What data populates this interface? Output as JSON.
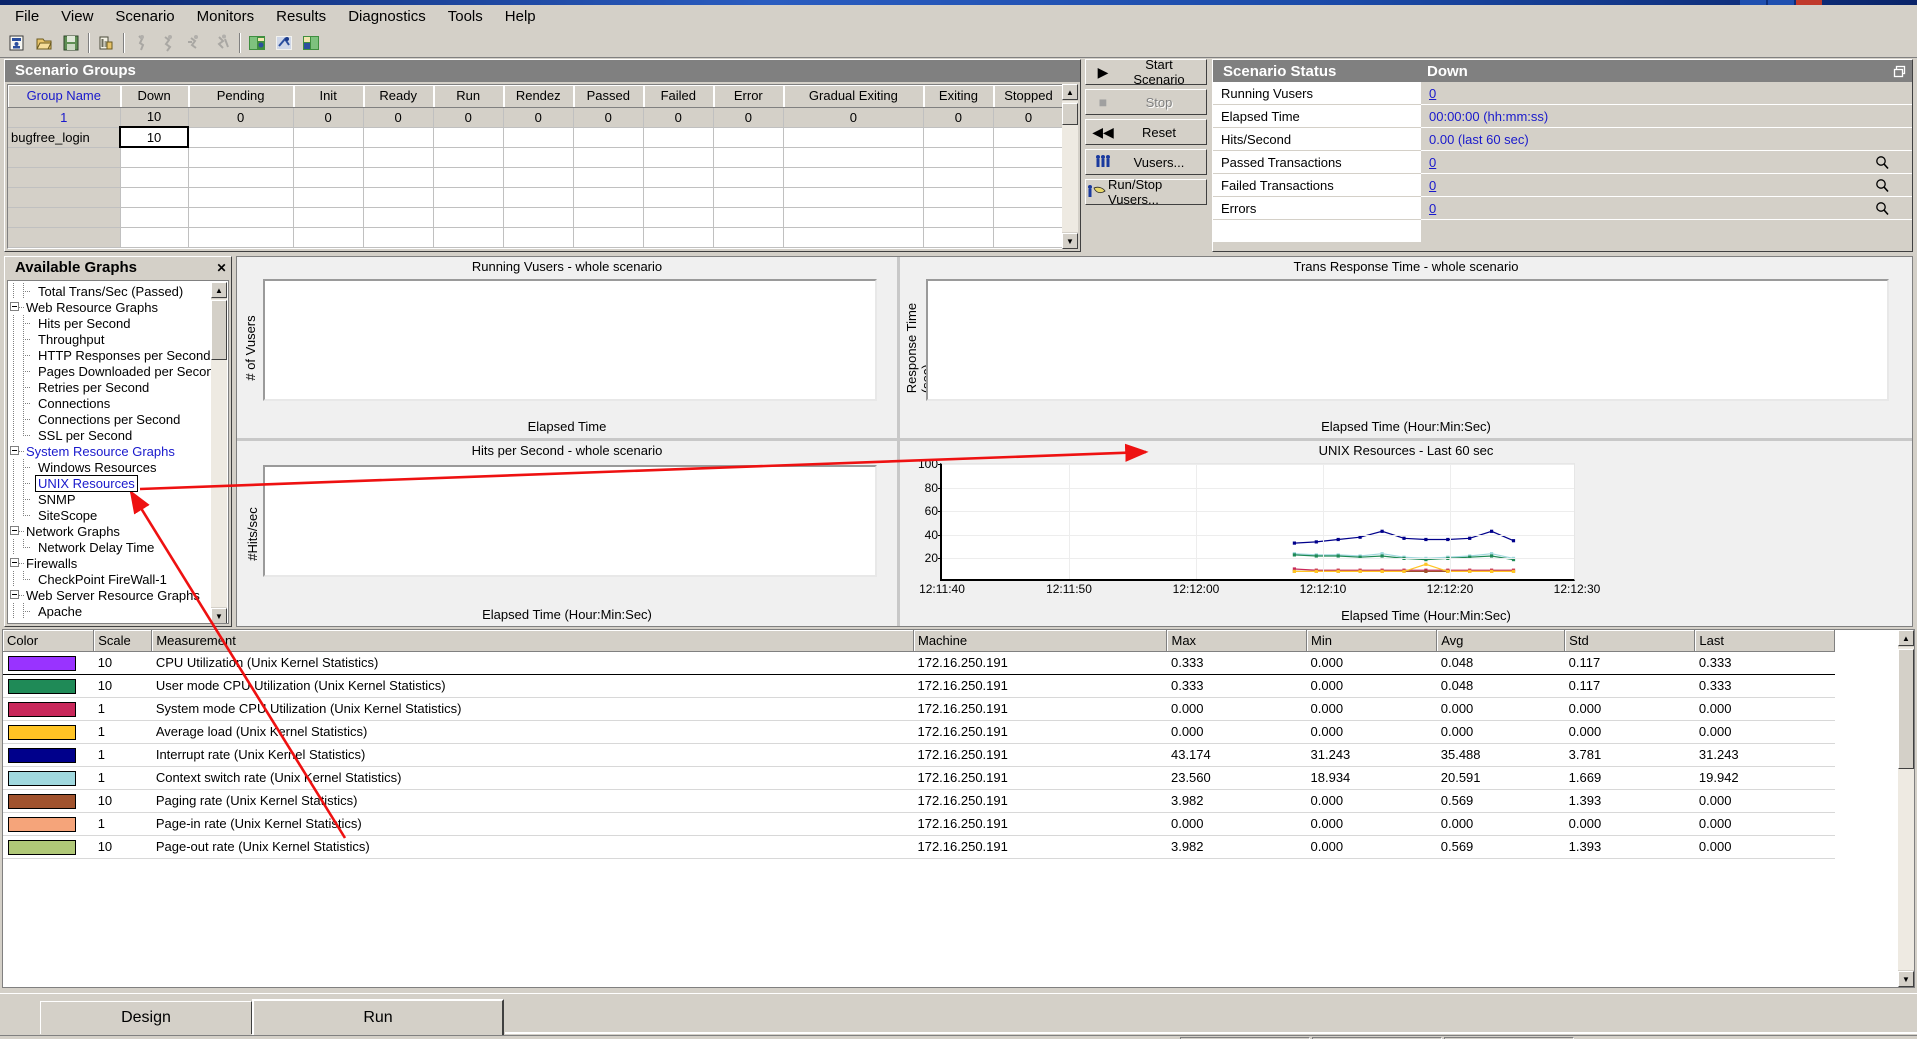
{
  "window": {
    "app_title": ""
  },
  "menubar": {
    "items": [
      {
        "label": "File"
      },
      {
        "label": "View"
      },
      {
        "label": "Scenario"
      },
      {
        "label": "Monitors"
      },
      {
        "label": "Results"
      },
      {
        "label": "Diagnostics"
      },
      {
        "label": "Tools"
      },
      {
        "label": "Help"
      }
    ]
  },
  "toolbar": {
    "buttons": [
      {
        "name": "new-scenario-icon"
      },
      {
        "name": "open-scenario-icon"
      },
      {
        "name": "save-scenario-icon"
      },
      {
        "name": "separator"
      },
      {
        "name": "report-icon"
      },
      {
        "name": "separator"
      },
      {
        "name": "start-scenario-icon"
      },
      {
        "name": "stop-scenario-icon"
      },
      {
        "name": "reset-scenario-icon"
      },
      {
        "name": "stop-now-icon"
      },
      {
        "name": "separator"
      },
      {
        "name": "vuser-details-icon"
      },
      {
        "name": "run-stop-vusers-icon"
      },
      {
        "name": "design-view-icon"
      }
    ]
  },
  "scenario_groups": {
    "title": "Scenario Groups",
    "columns": [
      "Group Name",
      "Down",
      "Pending",
      "Init",
      "Ready",
      "Run",
      "Rendez",
      "Passed",
      "Failed",
      "Error",
      "Gradual Exiting",
      "Exiting",
      "Stopped"
    ],
    "totals_row": [
      "1",
      "10",
      "0",
      "0",
      "0",
      "0",
      "0",
      "0",
      "0",
      "0",
      "0",
      "0",
      "0"
    ],
    "rows": [
      {
        "group_name": "bugfree_login",
        "down": "10",
        "selected_cell": "down"
      }
    ],
    "empty_row_count": 5
  },
  "controls": {
    "buttons": [
      {
        "label": "Start Scenario",
        "icon": "play-icon",
        "accel": "S",
        "disabled": false
      },
      {
        "label": "Stop",
        "icon": "stop-icon",
        "accel": "t",
        "disabled": true
      },
      {
        "label": "Reset",
        "icon": "rewind-icon",
        "accel": "e",
        "disabled": false
      },
      {
        "label": "Vusers...",
        "icon": "vusers-icon",
        "accel": "u",
        "disabled": false
      },
      {
        "label": "Run/Stop Vusers...",
        "icon": "run-stop-vusers-icon",
        "accel": "p",
        "disabled": false
      }
    ]
  },
  "scenario_status": {
    "title": "Scenario Status",
    "state": "Down",
    "restore_icon": "restore-window-icon",
    "rows": [
      {
        "label": "Running Vusers",
        "value": "0",
        "magnifier": false,
        "link": true
      },
      {
        "label": "Elapsed Time",
        "value": "00:00:00 (hh:mm:ss)",
        "magnifier": false,
        "link": false
      },
      {
        "label": "Hits/Second",
        "value": "0.00 (last 60 sec)",
        "magnifier": false,
        "link": false
      },
      {
        "label": "Passed Transactions",
        "value": "0",
        "magnifier": true,
        "link": true
      },
      {
        "label": "Failed Transactions",
        "value": "0",
        "magnifier": true,
        "link": true
      },
      {
        "label": "Errors",
        "value": "0",
        "magnifier": true,
        "link": true
      }
    ]
  },
  "available_graphs": {
    "title": "Available Graphs",
    "close_icon": "close-icon",
    "tree": [
      {
        "label": "Total Trans/Sec (Passed)",
        "depth": 2,
        "type": "leaf",
        "selected": false,
        "blue": false
      },
      {
        "label": "Web Resource Graphs",
        "depth": 1,
        "type": "group",
        "selected": false,
        "blue": false
      },
      {
        "label": "Hits per Second",
        "depth": 2,
        "type": "leaf",
        "selected": false,
        "blue": false
      },
      {
        "label": "Throughput",
        "depth": 2,
        "type": "leaf",
        "selected": false,
        "blue": false
      },
      {
        "label": "HTTP Responses per Second",
        "depth": 2,
        "type": "leaf",
        "selected": false,
        "blue": false
      },
      {
        "label": "Pages Downloaded per Second",
        "depth": 2,
        "type": "leaf",
        "selected": false,
        "blue": false
      },
      {
        "label": "Retries per Second",
        "depth": 2,
        "type": "leaf",
        "selected": false,
        "blue": false
      },
      {
        "label": "Connections",
        "depth": 2,
        "type": "leaf",
        "selected": false,
        "blue": false
      },
      {
        "label": "Connections per Second",
        "depth": 2,
        "type": "leaf",
        "selected": false,
        "blue": false
      },
      {
        "label": "SSL per Second",
        "depth": 2,
        "type": "leaf-last",
        "selected": false,
        "blue": false
      },
      {
        "label": "System Resource Graphs",
        "depth": 1,
        "type": "group",
        "selected": false,
        "blue": true
      },
      {
        "label": "Windows Resources",
        "depth": 2,
        "type": "leaf",
        "selected": false,
        "blue": false
      },
      {
        "label": "UNIX Resources",
        "depth": 2,
        "type": "leaf",
        "selected": true,
        "blue": true
      },
      {
        "label": "SNMP",
        "depth": 2,
        "type": "leaf",
        "selected": false,
        "blue": false
      },
      {
        "label": "SiteScope",
        "depth": 2,
        "type": "leaf-last",
        "selected": false,
        "blue": false
      },
      {
        "label": "Network Graphs",
        "depth": 1,
        "type": "group",
        "selected": false,
        "blue": false
      },
      {
        "label": "Network Delay Time",
        "depth": 2,
        "type": "leaf-last",
        "selected": false,
        "blue": false
      },
      {
        "label": "Firewalls",
        "depth": 1,
        "type": "group",
        "selected": false,
        "blue": false
      },
      {
        "label": "CheckPoint FireWall-1",
        "depth": 2,
        "type": "leaf-last",
        "selected": false,
        "blue": false
      },
      {
        "label": "Web Server Resource Graphs",
        "depth": 1,
        "type": "group",
        "selected": false,
        "blue": false
      },
      {
        "label": "Apache",
        "depth": 2,
        "type": "leaf",
        "selected": false,
        "blue": false
      }
    ]
  },
  "graph_panels": [
    {
      "title": "Running Vusers - whole scenario",
      "xlabel": "Elapsed Time",
      "ylabel": "# of Vusers",
      "empty": true
    },
    {
      "title": "Trans Response Time - whole scenario",
      "xlabel": "Elapsed Time (Hour:Min:Sec)",
      "ylabel": "Response Time (sec)",
      "empty": true
    },
    {
      "title": "Hits per Second - whole scenario",
      "xlabel": "Elapsed Time (Hour:Min:Sec)",
      "ylabel": "#Hits/sec",
      "empty": true
    }
  ],
  "chart_data": {
    "type": "line",
    "title": "UNIX Resources - Last 60 sec",
    "xlabel": "Elapsed Time (Hour:Min:Sec)",
    "ylabel": "",
    "ylim": [
      0,
      100
    ],
    "yticks": [
      20,
      40,
      60,
      80,
      100
    ],
    "xticks": [
      "12:11:40",
      "12:11:50",
      "12:12:00",
      "12:12:10",
      "12:12:20",
      "12:12:30"
    ],
    "grid": true,
    "legend": "below-in-table",
    "x": [
      "12:12:02",
      "12:12:04",
      "12:12:06",
      "12:12:08",
      "12:12:10",
      "12:12:12",
      "12:12:14",
      "12:12:16",
      "12:12:18",
      "12:12:20",
      "12:12:22"
    ],
    "series": [
      {
        "name": "Interrupt rate (Unix Kernel Statistics)",
        "color": "#00008b",
        "values": [
          33,
          34,
          36,
          38,
          43,
          37,
          36,
          36,
          37,
          43,
          35
        ]
      },
      {
        "name": "Context switch rate (Unix Kernel Statistics)",
        "color": "#a0d8de",
        "values": [
          24,
          23,
          23,
          22,
          24,
          21,
          20,
          21,
          22,
          24,
          20
        ]
      },
      {
        "name": "User mode CPU Utilization (Unix Kernel Statistics)",
        "color": "#1f8a57",
        "values": [
          23,
          22,
          22,
          21,
          22,
          20,
          19,
          20,
          21,
          22,
          19
        ]
      },
      {
        "name": "System mode CPU Utilization (Unix Kernel Statistics)",
        "color": "#c8275a",
        "values": [
          11,
          10,
          10,
          10,
          10,
          10,
          10,
          10,
          10,
          10,
          10
        ]
      },
      {
        "name": "Paging rate (Unix Kernel Statistics)",
        "color": "#a0522d",
        "values": [
          9,
          9,
          9,
          9,
          9,
          9,
          9,
          9,
          9,
          9,
          9
        ]
      },
      {
        "name": "Average load (Unix Kernel Statistics)",
        "color": "#ffc424",
        "values": [
          9,
          9,
          9,
          9,
          9,
          9,
          15,
          9,
          9,
          9,
          9
        ]
      }
    ]
  },
  "measurements": {
    "columns": [
      "Color",
      "Scale",
      "Measurement",
      "Machine",
      "Max",
      "Min",
      "Avg",
      "Std",
      "Last"
    ],
    "rows": [
      {
        "color": "#9933ff",
        "scale": "10",
        "measurement": "CPU Utilization (Unix Kernel Statistics)",
        "machine": "172.16.250.191",
        "max": "0.333",
        "min": "0.000",
        "avg": "0.048",
        "std": "0.117",
        "last": "0.333",
        "selected": true
      },
      {
        "color": "#1f8a57",
        "scale": "10",
        "measurement": "User mode CPU Utilization (Unix Kernel Statistics)",
        "machine": "172.16.250.191",
        "max": "0.333",
        "min": "0.000",
        "avg": "0.048",
        "std": "0.117",
        "last": "0.333",
        "selected": false
      },
      {
        "color": "#c8275a",
        "scale": "1",
        "measurement": "System mode CPU Utilization (Unix Kernel Statistics)",
        "machine": "172.16.250.191",
        "max": "0.000",
        "min": "0.000",
        "avg": "0.000",
        "std": "0.000",
        "last": "0.000",
        "selected": false
      },
      {
        "color": "#ffc424",
        "scale": "1",
        "measurement": "Average load (Unix Kernel Statistics)",
        "machine": "172.16.250.191",
        "max": "0.000",
        "min": "0.000",
        "avg": "0.000",
        "std": "0.000",
        "last": "0.000",
        "selected": false
      },
      {
        "color": "#00008b",
        "scale": "1",
        "measurement": "Interrupt rate (Unix Kernel Statistics)",
        "machine": "172.16.250.191",
        "max": "43.174",
        "min": "31.243",
        "avg": "35.488",
        "std": "3.781",
        "last": "31.243",
        "selected": false
      },
      {
        "color": "#a0d8de",
        "scale": "1",
        "measurement": "Context switch rate (Unix Kernel Statistics)",
        "machine": "172.16.250.191",
        "max": "23.560",
        "min": "18.934",
        "avg": "20.591",
        "std": "1.669",
        "last": "19.942",
        "selected": false
      },
      {
        "color": "#a0522d",
        "scale": "10",
        "measurement": "Paging rate (Unix Kernel Statistics)",
        "machine": "172.16.250.191",
        "max": "3.982",
        "min": "0.000",
        "avg": "0.569",
        "std": "1.393",
        "last": "0.000",
        "selected": false
      },
      {
        "color": "#f5a47a",
        "scale": "1",
        "measurement": "Page-in rate (Unix Kernel Statistics)",
        "machine": "172.16.250.191",
        "max": "0.000",
        "min": "0.000",
        "avg": "0.000",
        "std": "0.000",
        "last": "0.000",
        "selected": false
      },
      {
        "color": "#b0c878",
        "scale": "10",
        "measurement": "Page-out rate (Unix Kernel Statistics)",
        "machine": "172.16.250.191",
        "max": "3.982",
        "min": "0.000",
        "avg": "0.569",
        "std": "1.393",
        "last": "0.000",
        "selected": false
      }
    ]
  },
  "tabs": [
    {
      "label": "Design",
      "active": false
    },
    {
      "label": "Run",
      "active": true
    }
  ],
  "colors": {
    "accent_blue": "#1919cc",
    "annotation_red": "#ee1111",
    "face": "#d4d0c8",
    "header_gray": "#808080"
  }
}
